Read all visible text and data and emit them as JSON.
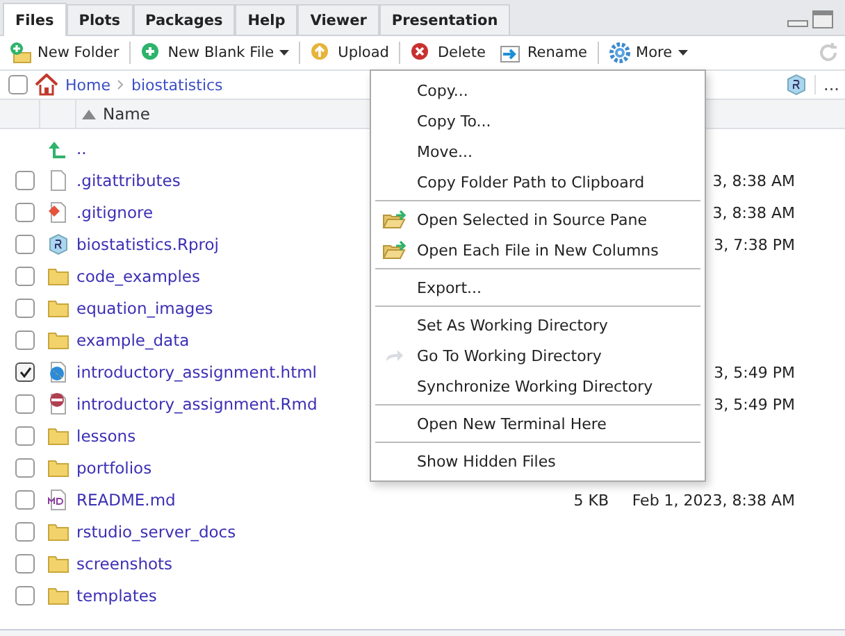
{
  "tabs": [
    {
      "label": "Files",
      "selected": true
    },
    {
      "label": "Plots",
      "selected": false
    },
    {
      "label": "Packages",
      "selected": false
    },
    {
      "label": "Help",
      "selected": false
    },
    {
      "label": "Viewer",
      "selected": false
    },
    {
      "label": "Presentation",
      "selected": false
    }
  ],
  "toolbar": [
    {
      "label": "New Folder",
      "kind": "folder",
      "dropdown": false
    },
    {
      "label": "New Blank File",
      "kind": "plus",
      "dropdown": true
    },
    {
      "label": "Upload",
      "kind": "upload",
      "dropdown": false
    },
    {
      "label": "Delete",
      "kind": "delete",
      "dropdown": false
    },
    {
      "label": "Rename",
      "kind": "rename",
      "dropdown": false
    },
    {
      "label": "More",
      "kind": "gear",
      "dropdown": true
    }
  ],
  "select_all_checked": false,
  "breadcrumb": [
    "Home",
    "biostatistics"
  ],
  "more_label": "...",
  "columns": {
    "name": "Name"
  },
  "rows": [
    {
      "name": "..",
      "kind": "up"
    },
    {
      "name": ".gitattributes",
      "kind": "file",
      "checked": false,
      "modified": "3, 8:38 AM"
    },
    {
      "name": ".gitignore",
      "kind": "git",
      "checked": false,
      "modified": "3, 8:38 AM"
    },
    {
      "name": "biostatistics.Rproj",
      "kind": "rproj",
      "checked": false,
      "modified": "3, 7:38 PM"
    },
    {
      "name": "code_examples",
      "kind": "folder",
      "checked": false
    },
    {
      "name": "equation_images",
      "kind": "folder",
      "checked": false
    },
    {
      "name": "example_data",
      "kind": "folder",
      "checked": false
    },
    {
      "name": "introductory_assignment.html",
      "kind": "html",
      "checked": true,
      "modified": "3, 5:49 PM"
    },
    {
      "name": "introductory_assignment.Rmd",
      "kind": "rmd",
      "checked": false,
      "modified": "3, 5:49 PM"
    },
    {
      "name": "lessons",
      "kind": "folder",
      "checked": false
    },
    {
      "name": "portfolios",
      "kind": "folder",
      "checked": false
    },
    {
      "name": "README.md",
      "kind": "md",
      "checked": false,
      "size": "5 KB",
      "modified": "Feb 1, 2023, 8:38 AM"
    },
    {
      "name": "rstudio_server_docs",
      "kind": "folder",
      "checked": false
    },
    {
      "name": "screenshots",
      "kind": "folder",
      "checked": false
    },
    {
      "name": "templates",
      "kind": "folder",
      "checked": false
    }
  ],
  "menu": [
    {
      "kind": "item",
      "label": "Copy..."
    },
    {
      "kind": "item",
      "label": "Copy To..."
    },
    {
      "kind": "item",
      "label": "Move..."
    },
    {
      "kind": "item",
      "label": "Copy Folder Path to Clipboard"
    },
    {
      "kind": "separator"
    },
    {
      "kind": "folder-item",
      "label": "Open Selected in Source Pane"
    },
    {
      "kind": "folder-item",
      "label": "Open Each File in New Columns"
    },
    {
      "kind": "separator"
    },
    {
      "kind": "item",
      "label": "Export..."
    },
    {
      "kind": "separator"
    },
    {
      "kind": "item",
      "label": "Set As Working Directory"
    },
    {
      "kind": "arrow-item",
      "label": "Go To Working Directory"
    },
    {
      "kind": "item",
      "label": "Synchronize Working Directory"
    },
    {
      "kind": "separator"
    },
    {
      "kind": "item",
      "label": "Open New Terminal Here"
    },
    {
      "kind": "separator"
    },
    {
      "kind": "item",
      "label": "Show Hidden Files"
    }
  ]
}
